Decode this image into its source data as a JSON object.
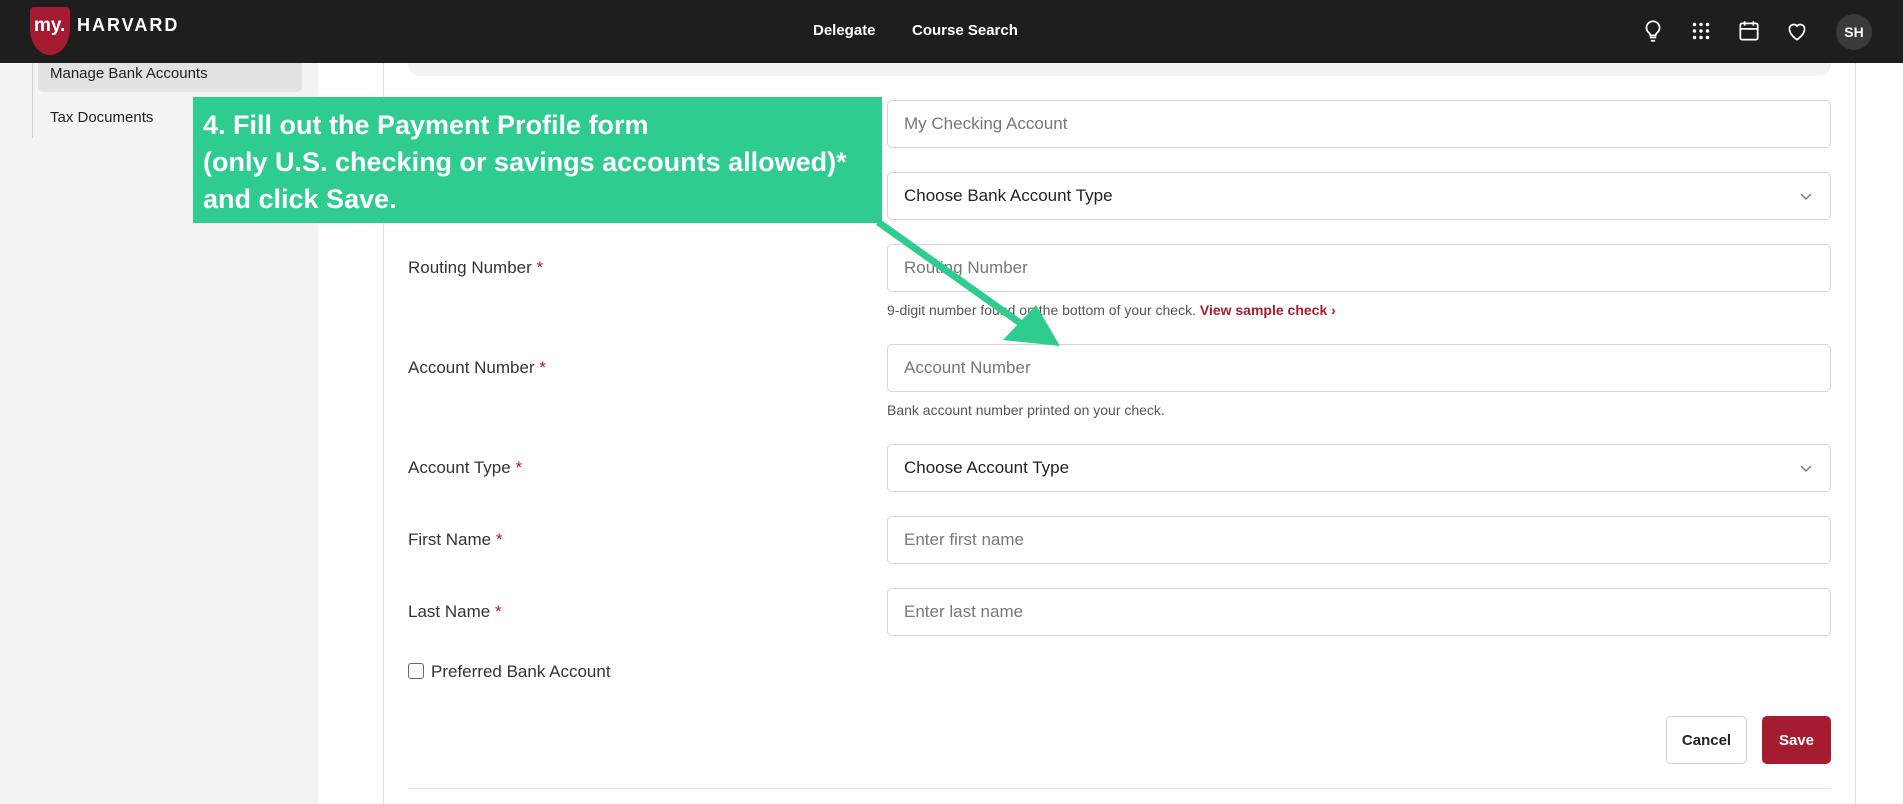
{
  "header": {
    "logo_my": "my.",
    "logo_name": "HARVARD",
    "nav": [
      "Delegate",
      "Course Search"
    ],
    "icons": [
      "lightbulb-icon",
      "apps-grid-icon",
      "calendar-icon",
      "heart-icon"
    ],
    "avatar_initials": "SH",
    "brand_color": "#a51c30"
  },
  "sidebar": {
    "items": [
      {
        "label": "Manage Bank Accounts",
        "active": true
      },
      {
        "label": "Tax Documents",
        "active": false
      }
    ]
  },
  "form": {
    "profile_name_placeholder": "My Checking Account",
    "bank_account_type_select": "Choose Bank Account Type",
    "routing": {
      "label": "Routing Number",
      "required": "*",
      "placeholder": "Routing Number",
      "hint": "9-digit number found on the bottom of your check.",
      "hint_link": "View sample check"
    },
    "account_number": {
      "label": "Account Number",
      "required": "*",
      "placeholder": "Account Number",
      "hint": "Bank account number printed on your check."
    },
    "account_type": {
      "label": "Account Type",
      "required": "*",
      "select": "Choose Account Type"
    },
    "first_name": {
      "label": "First Name",
      "required": "*",
      "placeholder": "Enter first name"
    },
    "last_name": {
      "label": "Last Name",
      "required": "*",
      "placeholder": "Enter last name"
    },
    "preferred_label": "Preferred Bank Account",
    "cancel_label": "Cancel",
    "save_label": "Save"
  },
  "annotation": {
    "lines": [
      "4. Fill out the Payment Profile form",
      "(only U.S. checking or savings accounts allowed)*",
      "and click Save."
    ],
    "color": "#2ecc8e"
  }
}
